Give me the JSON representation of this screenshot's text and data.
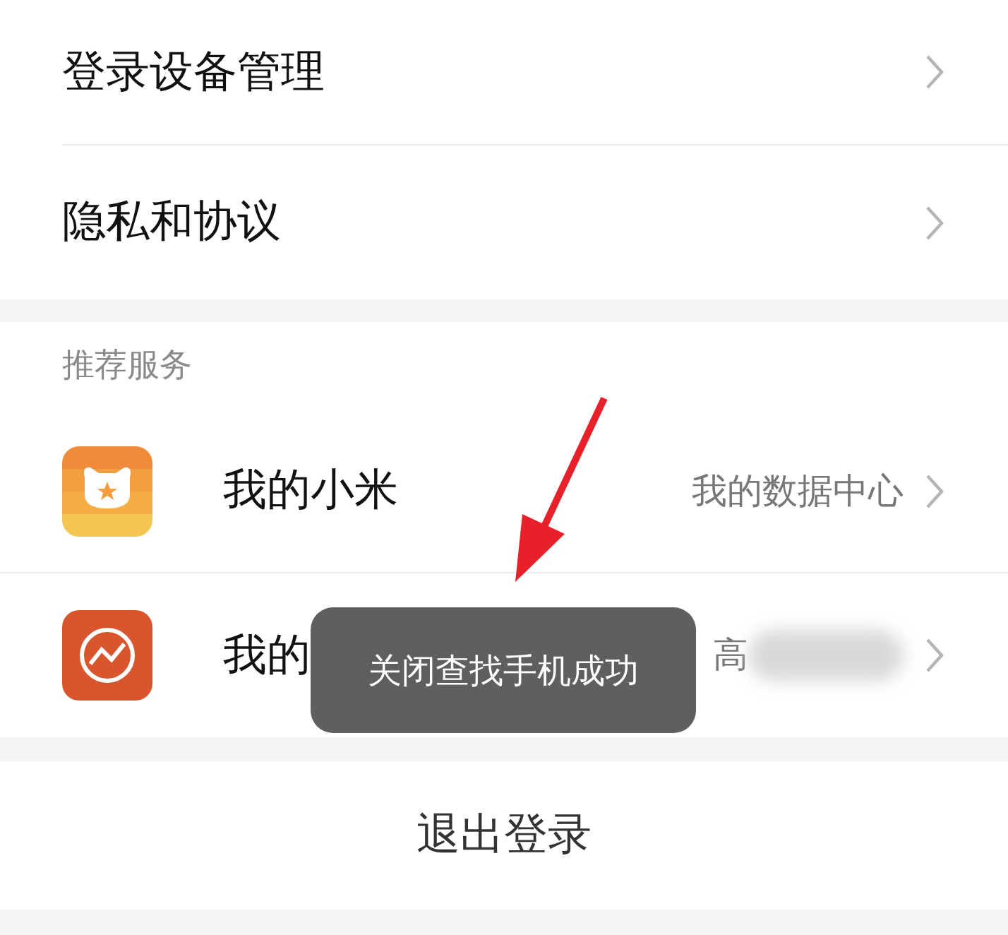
{
  "settings_items": [
    {
      "label": "登录设备管理"
    },
    {
      "label": "隐私和协议"
    }
  ],
  "recommended": {
    "header": "推荐服务",
    "items": [
      {
        "kind": "mi",
        "title": "我的小米",
        "detail": "我的数据中心"
      },
      {
        "kind": "assets",
        "title": "我的",
        "detail": "高",
        "blurred": true
      }
    ]
  },
  "logout_button": "退出登录",
  "toast": "关闭查找手机成功"
}
